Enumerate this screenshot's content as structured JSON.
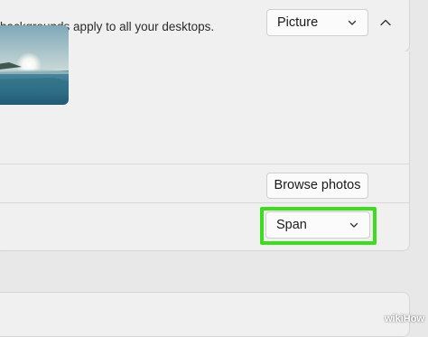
{
  "background_section": {
    "description": "backgrounds apply to all your desktops.",
    "type_select_value": "Picture",
    "collapse_icon": "chevron-up-icon"
  },
  "photos": {
    "browse_label": "Browse photos"
  },
  "fit": {
    "select_value": "Span",
    "highlight_color": "#3ddc1f"
  },
  "watermark": {
    "text": "wikiHow"
  }
}
